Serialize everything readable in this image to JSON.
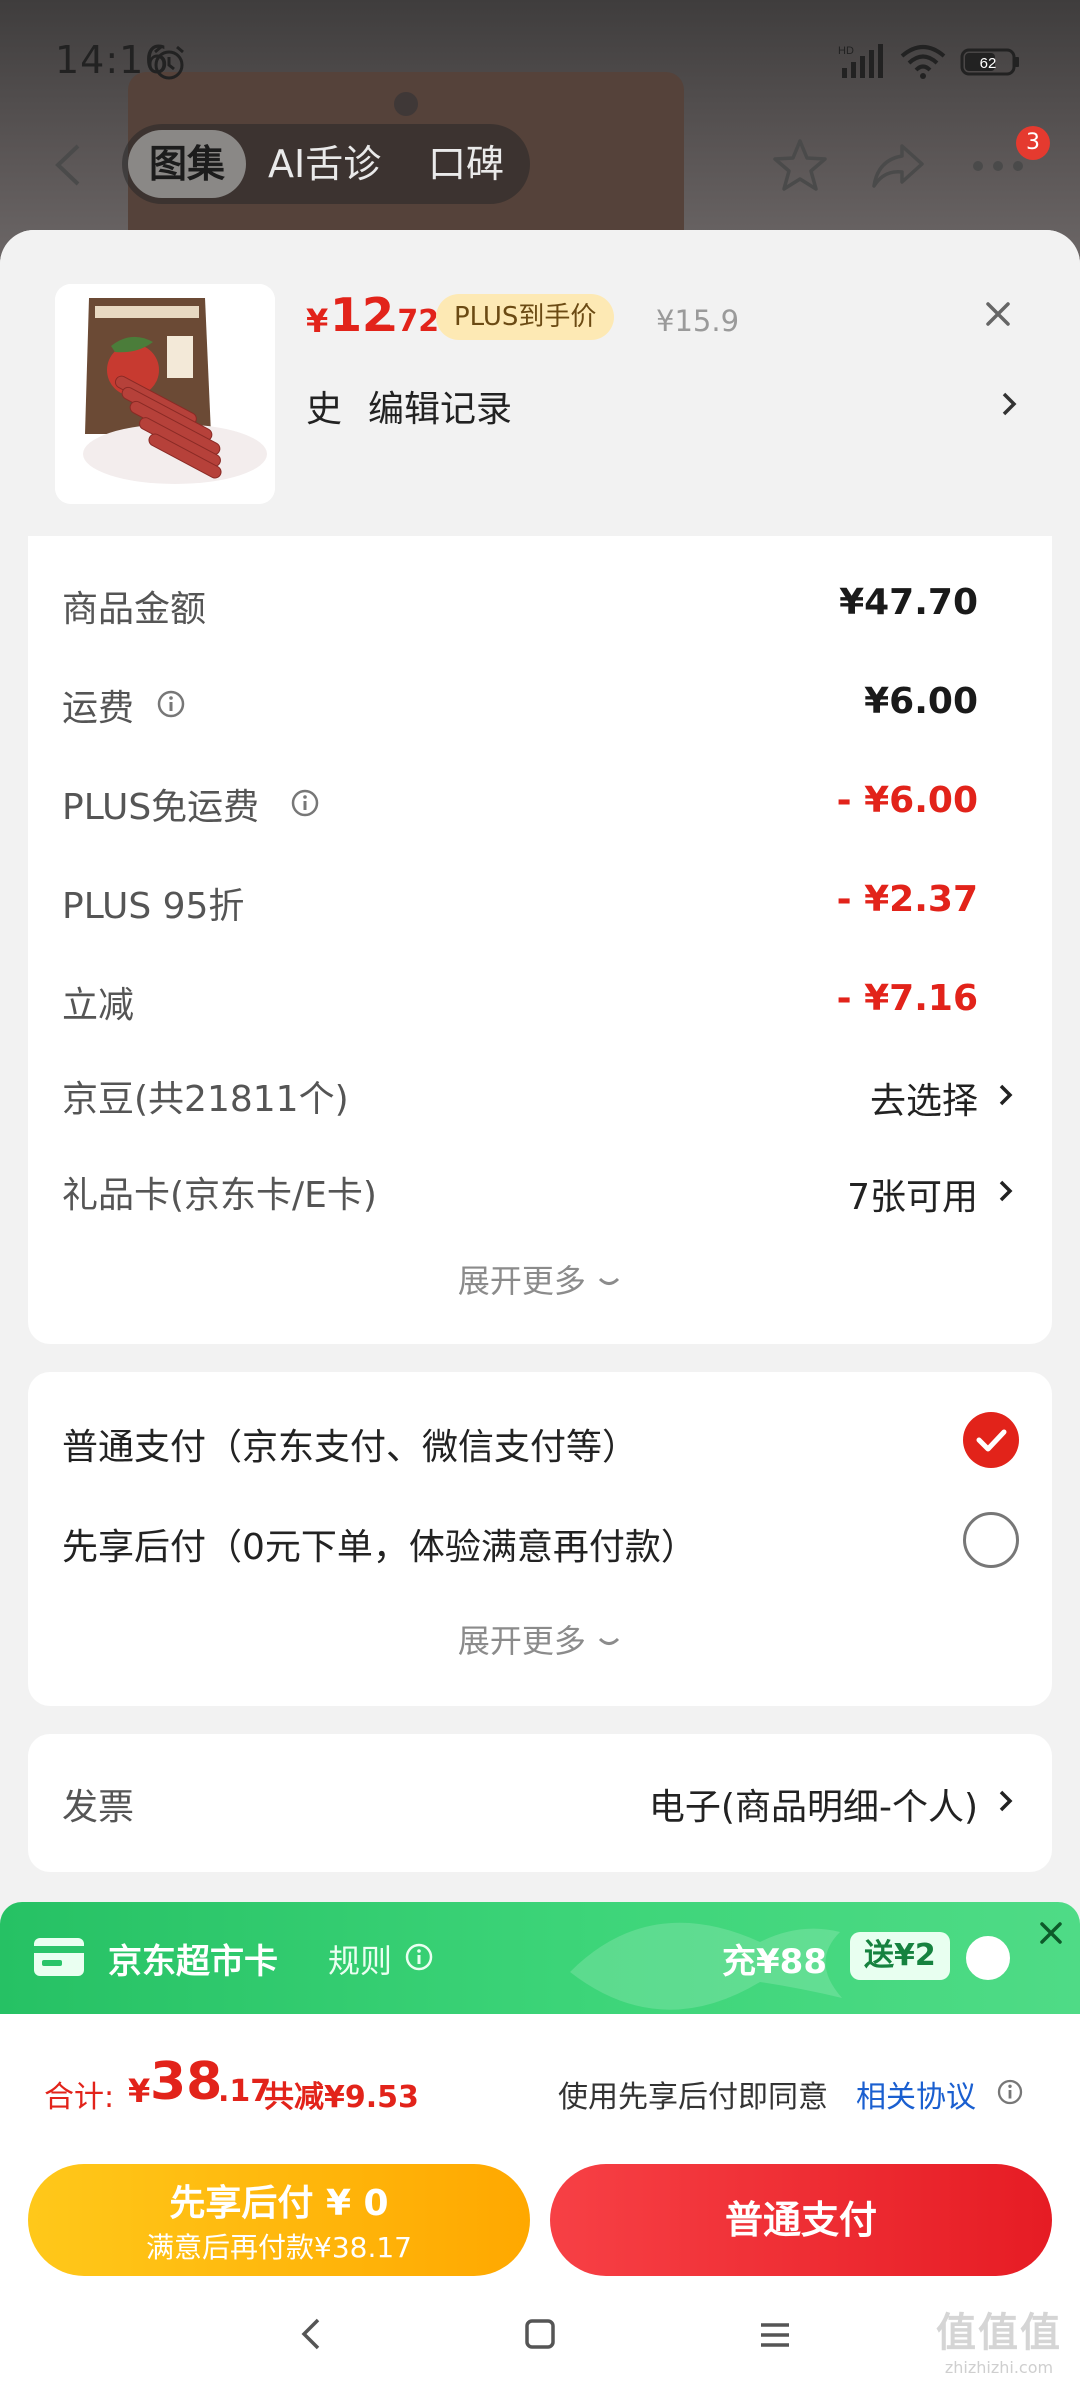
{
  "status_bar": {
    "time": "14:16",
    "battery": "62"
  },
  "top_nav": {
    "tabs": [
      {
        "label": "图集",
        "active": true
      },
      {
        "label": "AI舌诊",
        "active": false
      },
      {
        "label": "口碑",
        "active": false
      }
    ],
    "more_badge": "3"
  },
  "product": {
    "currency": "¥",
    "price_int": "12",
    "price_dec": ".72",
    "plus_badge": "PLUS到手价",
    "original_price": "¥15.9",
    "history_name": "史",
    "history_link": "编辑记录"
  },
  "price_details": {
    "rows": [
      {
        "label": "商品金额",
        "value": "¥47.70"
      },
      {
        "label": "运费",
        "value": "¥6.00"
      },
      {
        "label": "PLUS免运费",
        "value": "- ¥6.00"
      },
      {
        "label": "PLUS 95折",
        "value": "- ¥2.37"
      },
      {
        "label": "立减",
        "value": "- ¥7.16"
      },
      {
        "label": "京豆(共21811个)",
        "action": "去选择"
      },
      {
        "label": "礼品卡(京东卡/E卡)",
        "action": "7张可用"
      }
    ],
    "expand_label": "展开更多"
  },
  "payment": {
    "options": [
      {
        "label": "普通支付（京东支付、微信支付等）",
        "selected": true
      },
      {
        "label": "先享后付（0元下单，体验满意再付款）",
        "selected": false
      }
    ],
    "expand_label": "展开更多"
  },
  "invoice": {
    "label": "发票",
    "value": "电子(商品明细-个人)"
  },
  "market_card": {
    "title": "京东超市卡",
    "rules": "规则",
    "recharge": "充¥88",
    "bonus": "送¥2"
  },
  "footer": {
    "total_label": "合计:",
    "total_currency": "¥",
    "total_int": "38",
    "total_dec": ".17",
    "total_saved": "共减¥9.53",
    "agree_text": "使用先享后付即同意",
    "agree_link": "相关协议",
    "btn_later_main": "先享后付 ¥ 0",
    "btn_later_sub": "满意后再付款¥38.17",
    "btn_normal": "普通支付"
  },
  "watermark": {
    "logo": "值值值",
    "url": "zhizhizhi.com"
  },
  "colors": {
    "accent": "#e2231a",
    "plus_gold": "#fde9b4",
    "market_green": "#26c164",
    "later_yellow": "#ffb400"
  }
}
